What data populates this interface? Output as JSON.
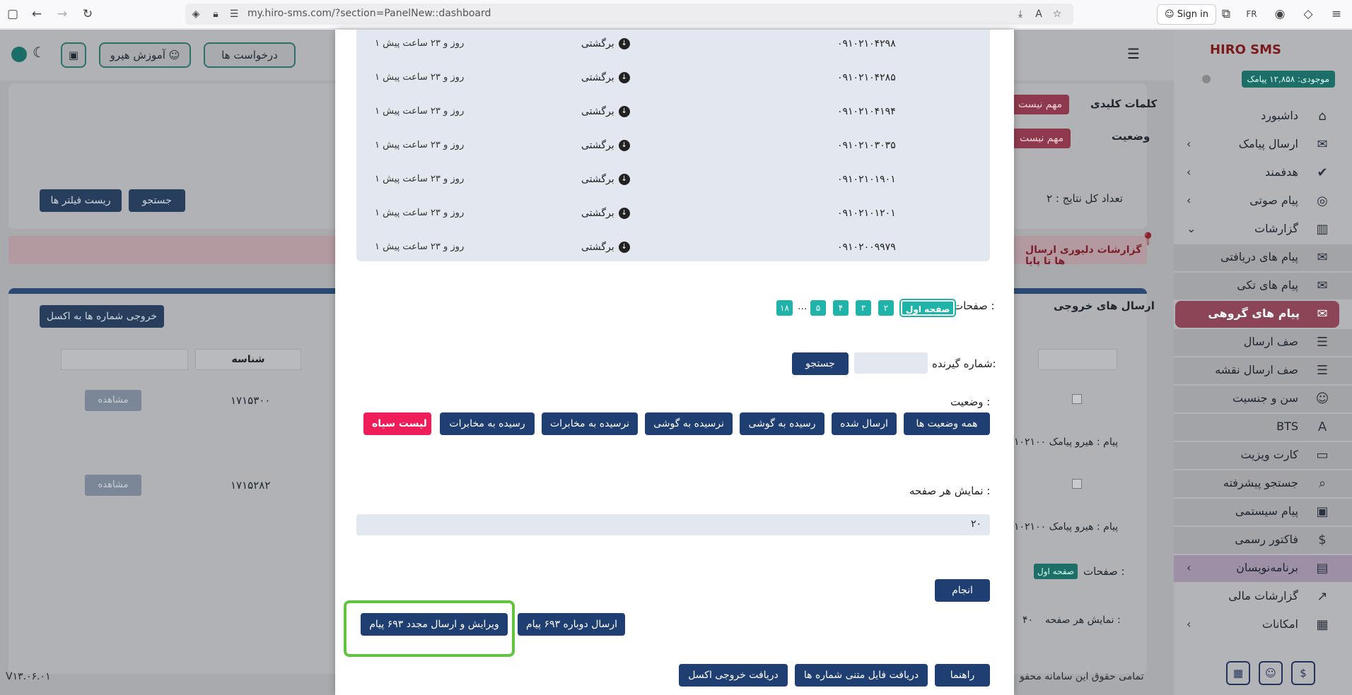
{
  "browser": {
    "url": "my.hiro-sms.com/?section=PanelNew::dashboard",
    "signin_label": "Sign in",
    "ext_badge": "FR"
  },
  "topbar": {
    "requests_label": "درخواست ها",
    "training_label": "آموزش هیرو"
  },
  "sidebar": {
    "logo_text": "HIRO SMS",
    "credit": "موجودی: ۱۲,۸۵۸ پیامک",
    "items": [
      {
        "label": "داشبورد",
        "icon": "⌂"
      },
      {
        "label": "ارسال پیامک",
        "icon": "✉"
      },
      {
        "label": "هدفمند",
        "icon": "✔"
      },
      {
        "label": "پیام صوتی",
        "icon": "◎"
      },
      {
        "label": "گزارشات",
        "icon": "▥"
      },
      {
        "label": "پیام های دریافتی",
        "icon": "✉"
      },
      {
        "label": "پیام های تکی",
        "icon": "✉"
      },
      {
        "label": "پیام های گروهی",
        "icon": "✉"
      },
      {
        "label": "صف ارسال",
        "icon": "☰"
      },
      {
        "label": "صف ارسال نقشه",
        "icon": "☰"
      },
      {
        "label": "سن و جنسیت",
        "icon": "☺"
      },
      {
        "label": "BTS",
        "icon": "A"
      },
      {
        "label": "کارت ویزیت",
        "icon": "▭"
      },
      {
        "label": "جستجو پیشرفته",
        "icon": "⌕"
      },
      {
        "label": "پیام سیستمی",
        "icon": "▣"
      },
      {
        "label": "فاکتور رسمی",
        "icon": "$"
      },
      {
        "label": "برنامه‌نویسان",
        "icon": "▤"
      },
      {
        "label": "گزارشات مالی",
        "icon": "↗"
      },
      {
        "label": "امکانات",
        "icon": "▦"
      }
    ]
  },
  "background": {
    "keywords_label": "کلمات کلیدی",
    "status_label": "وضعیت",
    "not_important": "مهم نیست",
    "total_results": "تعداد کل نتایج : ۲",
    "search_btn": "جستجو",
    "reset_btn": "ریست فیلتر ها",
    "alert_text": "گزارشات دلیوری ارسال ها تا پایا",
    "outgoing_title": "ارسال های خروجی",
    "excel_export_btn": "خروجی شماره ها به اکسل",
    "id_header": "شناسه",
    "rows": [
      {
        "id": "۱۷۱۵۳۰۰",
        "view": "مشاهده",
        "message": "پیام : هیرو پیامک ۱۰۲۱۰۰"
      },
      {
        "id": "۱۷۱۵۲۸۲",
        "view": "مشاهده",
        "message": "پیام : هیرو پیامک ۱۰۲۱۰۰"
      }
    ],
    "pages_label": "صفحات :",
    "first_page": "صفحه اول",
    "per_page_label": "نمایش هر صفحه :",
    "per_page_value": "۴۰",
    "copyright": "تمامی حقوق این سامانه محفو",
    "version": "V۱۳.۰۶.۰۱"
  },
  "modal": {
    "rows": [
      {
        "number": "۰۹۱۰۲۱۰۴۲۹۸",
        "status": "برگشتی",
        "time": "۱ روز و ۲۳ ساعت پیش"
      },
      {
        "number": "۰۹۱۰۲۱۰۴۲۸۵",
        "status": "برگشتی",
        "time": "۱ روز و ۲۳ ساعت پیش"
      },
      {
        "number": "۰۹۱۰۲۱۰۴۱۹۴",
        "status": "برگشتی",
        "time": "۱ روز و ۲۳ ساعت پیش"
      },
      {
        "number": "۰۹۱۰۲۱۰۳۰۳۵",
        "status": "برگشتی",
        "time": "۱ روز و ۲۳ ساعت پیش"
      },
      {
        "number": "۰۹۱۰۲۱۰۱۹۰۱",
        "status": "برگشتی",
        "time": "۱ روز و ۲۳ ساعت پیش"
      },
      {
        "number": "۰۹۱۰۲۱۰۱۲۰۱",
        "status": "برگشتی",
        "time": "۱ روز و ۲۳ ساعت پیش"
      },
      {
        "number": "۰۹۱۰۲۰۰۹۹۷۹",
        "status": "برگشتی",
        "time": "۱ روز و ۲۳ ساعت پیش"
      }
    ],
    "pages_label": "صفحات :",
    "pages": [
      "صفحه اول",
      "۲",
      "۳",
      "۴",
      "۵",
      "...",
      "۱۸"
    ],
    "receiver_label": "شماره گیرنده:",
    "receiver_value": "",
    "search_btn": "جستجو",
    "status_label": "وضعیت :",
    "status_filters": [
      "همه وضعیت ها",
      "ارسال شده",
      "رسیده به گوشی",
      "نرسیده به گوشی",
      "نرسیده به مخابرات",
      "رسیده به مخابرات",
      "لیست سیاه"
    ],
    "per_page_label": "نمایش هر صفحه :",
    "per_page_value": "۲۰",
    "apply_btn": "انجام",
    "resend_btn": "ارسال دوباره ۶۹۳ پیام",
    "edit_resend_btn": "ویرایش و ارسال مجدد ۶۹۳ پیام",
    "guide_btn": "راهنما",
    "text_file_btn": "دریافت فایل متنی شماره ها",
    "excel_btn": "دریافت خروجی اکسل"
  }
}
